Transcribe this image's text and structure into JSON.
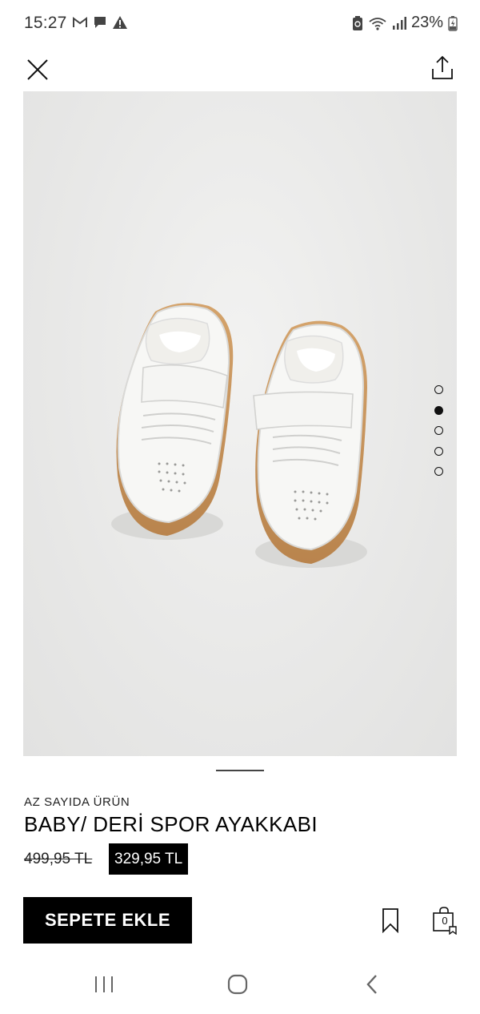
{
  "status_bar": {
    "time": "15:27",
    "left_icons": [
      "gmail-icon",
      "chat-icon",
      "warning-icon"
    ],
    "right_icons": [
      "recycle-icon",
      "wifi-icon",
      "signal-icon",
      "battery-charging-icon"
    ],
    "battery": "23%"
  },
  "toolbar": {
    "close_icon": "close-icon",
    "share_icon": "share-icon"
  },
  "gallery": {
    "image_count": 5,
    "active_index": 1
  },
  "product": {
    "stock_label": "AZ SAYIDA ÜRÜN",
    "name": "BABY/ DERİ SPOR AYAKKABI",
    "old_price": "499,95 TL",
    "new_price": "329,95 TL"
  },
  "actions": {
    "add_to_cart_label": "SEPETE EKLE",
    "bag_count": "0"
  },
  "nav": {
    "recents_icon": "recents-icon",
    "home_icon": "home-icon",
    "back_icon": "back-icon"
  }
}
